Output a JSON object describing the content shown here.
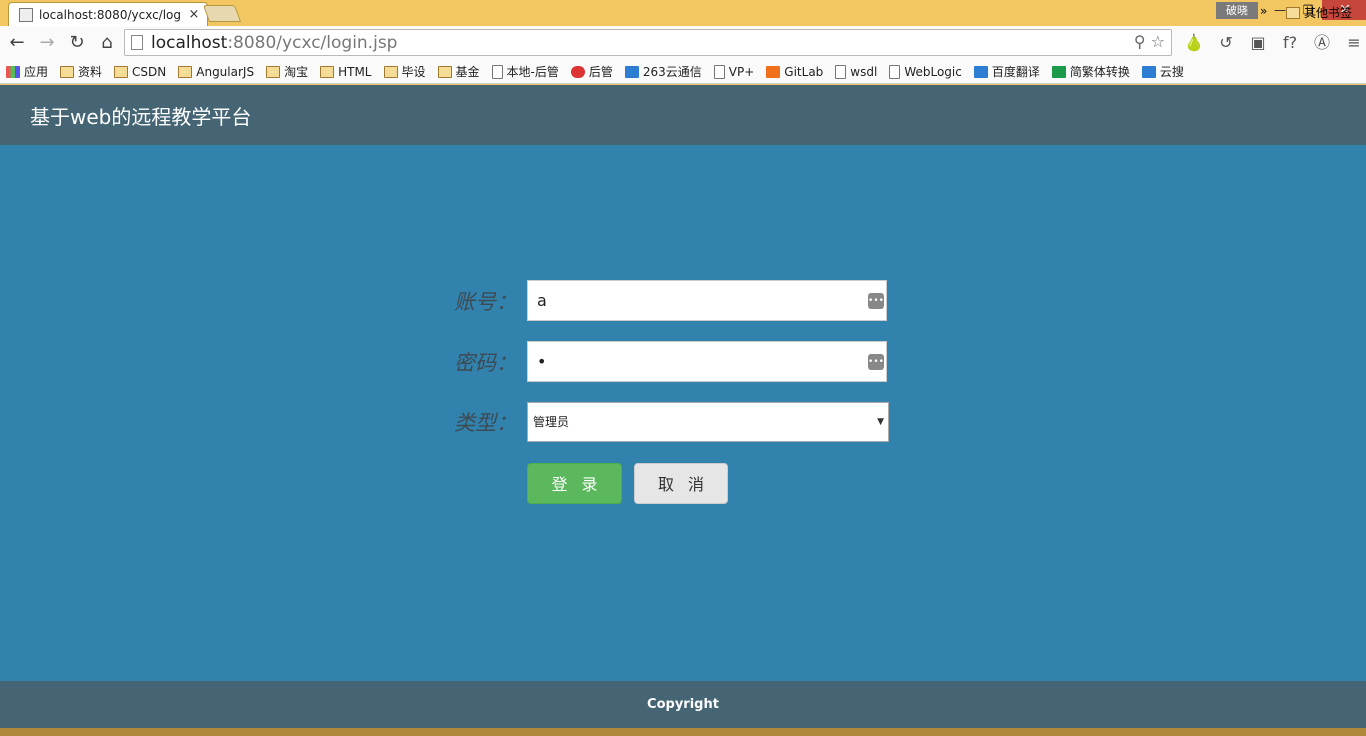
{
  "browser": {
    "tab_title": "localhost:8080/ycxc/log",
    "tab_close": "×",
    "user_badge": "破晓",
    "win_minimize": "—",
    "win_restore": "❐",
    "win_close": "✕",
    "nav_back": "←",
    "nav_forward": "→",
    "nav_reload": "↻",
    "nav_home": "⌂",
    "url_host": "localhost",
    "url_path": ":8080/ycxc/login.jsp",
    "omni_right": "⚲ ☆"
  },
  "extensions": [
    "🍐",
    "↺",
    "▣",
    "f?",
    "Ⓐ",
    "≡"
  ],
  "bookmarks": [
    {
      "label": "应用",
      "icon": "grid"
    },
    {
      "label": "资料",
      "icon": "folder"
    },
    {
      "label": "CSDN",
      "icon": "folder"
    },
    {
      "label": "AngularJS",
      "icon": "folder"
    },
    {
      "label": "淘宝",
      "icon": "folder"
    },
    {
      "label": "HTML",
      "icon": "folder"
    },
    {
      "label": "毕设",
      "icon": "folder"
    },
    {
      "label": "基金",
      "icon": "folder"
    },
    {
      "label": "本地-后管",
      "icon": "page"
    },
    {
      "label": "后管",
      "icon": "red"
    },
    {
      "label": "263云通信",
      "icon": "blue"
    },
    {
      "label": "VP+",
      "icon": "page"
    },
    {
      "label": "GitLab",
      "icon": "orange"
    },
    {
      "label": "wsdl",
      "icon": "page"
    },
    {
      "label": "WebLogic",
      "icon": "page"
    },
    {
      "label": "百度翻译",
      "icon": "blue"
    },
    {
      "label": "简繁体转换",
      "icon": "green"
    },
    {
      "label": "云搜",
      "icon": "blue"
    }
  ],
  "bookmarks_more": "»",
  "bookmarks_other": "其他书签",
  "header": {
    "title": "基于web的远程教学平台"
  },
  "form": {
    "account_label": "账号：",
    "account_value": "a",
    "password_label": "密码：",
    "password_value": "•",
    "type_label": "类型：",
    "type_selected": "管理员",
    "login_label": "登录",
    "cancel_label": "取消",
    "pw_icon": "•••"
  },
  "footer": {
    "copyright": "Copyright"
  }
}
